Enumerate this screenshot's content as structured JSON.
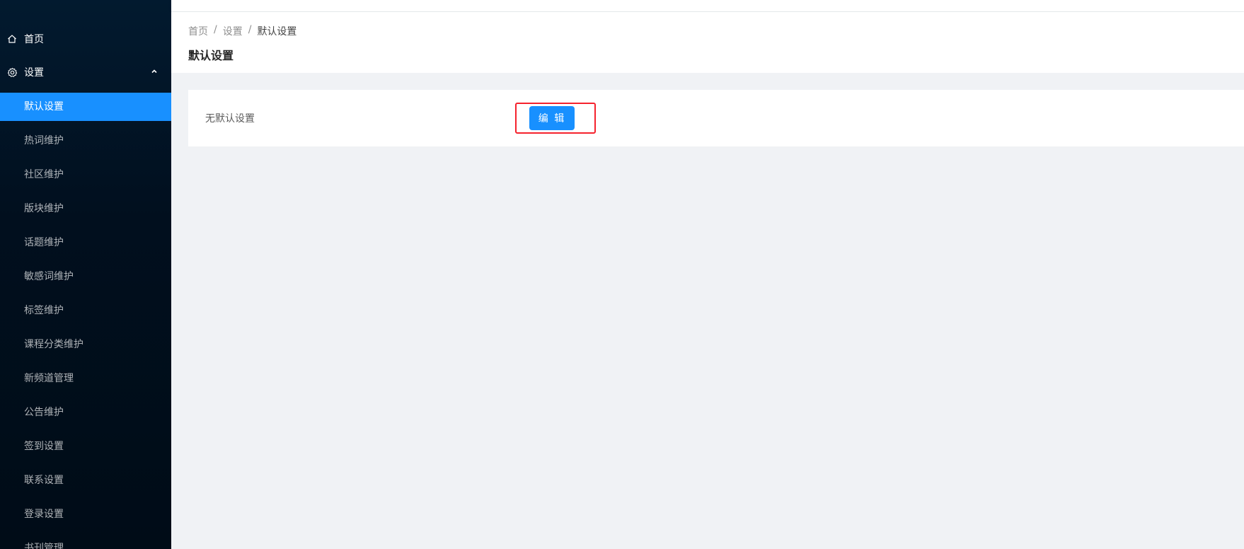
{
  "sidebar": {
    "home_label": "首页",
    "settings_label": "设置",
    "submenu": [
      {
        "label": "默认设置",
        "active": true
      },
      {
        "label": "热词维护"
      },
      {
        "label": "社区维护"
      },
      {
        "label": "版块维护"
      },
      {
        "label": "话题维护"
      },
      {
        "label": "敏感词维护"
      },
      {
        "label": "标签维护"
      },
      {
        "label": "课程分类维护"
      },
      {
        "label": "新频道管理"
      },
      {
        "label": "公告维护"
      },
      {
        "label": "签到设置"
      },
      {
        "label": "联系设置"
      },
      {
        "label": "登录设置"
      },
      {
        "label": "书刊管理"
      }
    ]
  },
  "breadcrumb": {
    "items": [
      "首页",
      "设置",
      "默认设置"
    ],
    "separator": "/"
  },
  "page": {
    "title": "默认设置"
  },
  "card": {
    "label": "无默认设置",
    "edit_button": "编 辑"
  },
  "colors": {
    "sidebar_bg": "#001529",
    "accent": "#1890ff",
    "highlight": "#f5222d"
  },
  "icons": {
    "home": "home-icon",
    "settings": "setting-icon",
    "collapse": "chevron-up-icon"
  }
}
